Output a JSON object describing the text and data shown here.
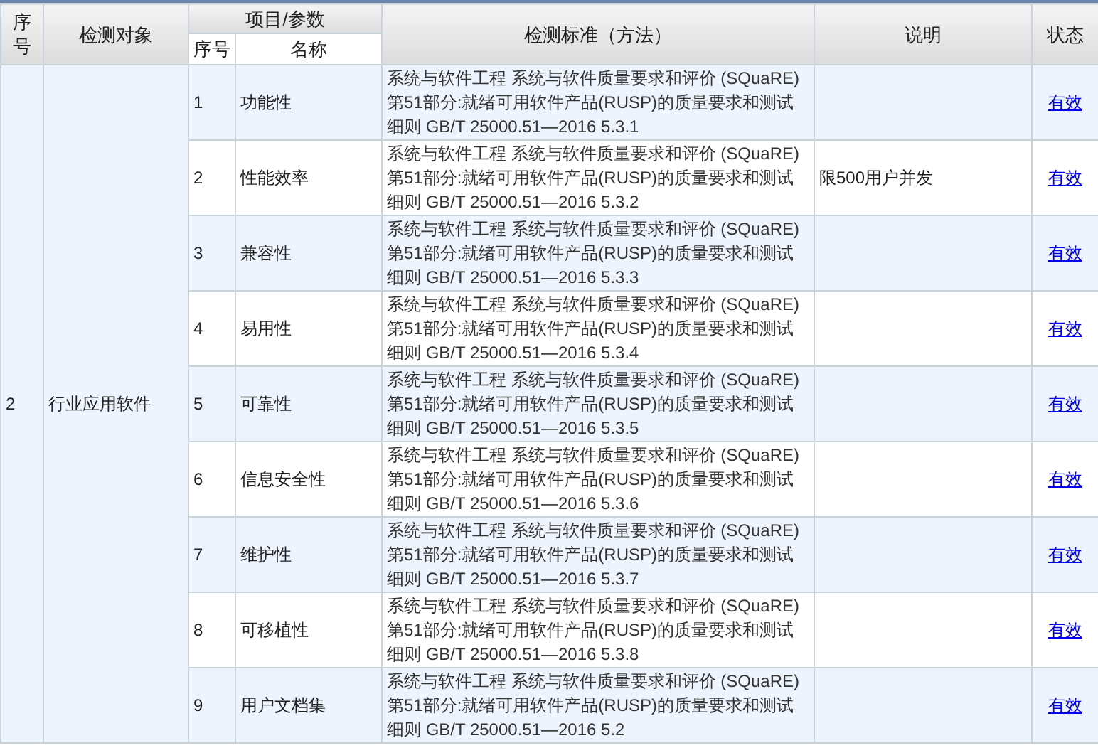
{
  "table": {
    "columns": {
      "no": "序号",
      "object": "检测对象",
      "group": "项目/参数",
      "item_no": "序号",
      "item_name": "名称",
      "standard": "检测标准（方法）",
      "note": "说明",
      "status": "状态"
    },
    "group_row": {
      "no": "2",
      "object": "行业应用软件"
    },
    "rows": [
      {
        "no": "1",
        "name": "功能性",
        "standard": "系统与软件工程 系统与软件质量要求和评价 (SQuaRE) 第51部分:就绪可用软件产品(RUSP)的质量要求和测试细则 GB/T 25000.51—2016 5.3.1",
        "note": "",
        "status": "有效"
      },
      {
        "no": "2",
        "name": "性能效率",
        "standard": "系统与软件工程 系统与软件质量要求和评价 (SQuaRE) 第51部分:就绪可用软件产品(RUSP)的质量要求和测试细则 GB/T 25000.51—2016 5.3.2",
        "note": "限500用户并发",
        "status": "有效"
      },
      {
        "no": "3",
        "name": "兼容性",
        "standard": "系统与软件工程 系统与软件质量要求和评价 (SQuaRE) 第51部分:就绪可用软件产品(RUSP)的质量要求和测试细则 GB/T 25000.51—2016 5.3.3",
        "note": "",
        "status": "有效"
      },
      {
        "no": "4",
        "name": "易用性",
        "standard": "系统与软件工程 系统与软件质量要求和评价 (SQuaRE) 第51部分:就绪可用软件产品(RUSP)的质量要求和测试细则 GB/T 25000.51—2016 5.3.4",
        "note": "",
        "status": "有效"
      },
      {
        "no": "5",
        "name": "可靠性",
        "standard": "系统与软件工程 系统与软件质量要求和评价 (SQuaRE) 第51部分:就绪可用软件产品(RUSP)的质量要求和测试细则 GB/T 25000.51—2016 5.3.5",
        "note": "",
        "status": "有效"
      },
      {
        "no": "6",
        "name": "信息安全性",
        "standard": "系统与软件工程 系统与软件质量要求和评价 (SQuaRE) 第51部分:就绪可用软件产品(RUSP)的质量要求和测试细则 GB/T 25000.51—2016 5.3.6",
        "note": "",
        "status": "有效"
      },
      {
        "no": "7",
        "name": "维护性",
        "standard": "系统与软件工程 系统与软件质量要求和评价 (SQuaRE) 第51部分:就绪可用软件产品(RUSP)的质量要求和测试细则 GB/T 25000.51—2016 5.3.7",
        "note": "",
        "status": "有效"
      },
      {
        "no": "8",
        "name": "可移植性",
        "standard": "系统与软件工程 系统与软件质量要求和评价 (SQuaRE) 第51部分:就绪可用软件产品(RUSP)的质量要求和测试细则 GB/T 25000.51—2016 5.3.8",
        "note": "",
        "status": "有效"
      },
      {
        "no": "9",
        "name": "用户文档集",
        "standard": "系统与软件工程 系统与软件质量要求和评价 (SQuaRE) 第51部分:就绪可用软件产品(RUSP)的质量要求和测试细则 GB/T 25000.51—2016 5.2",
        "note": "",
        "status": "有效"
      }
    ]
  }
}
